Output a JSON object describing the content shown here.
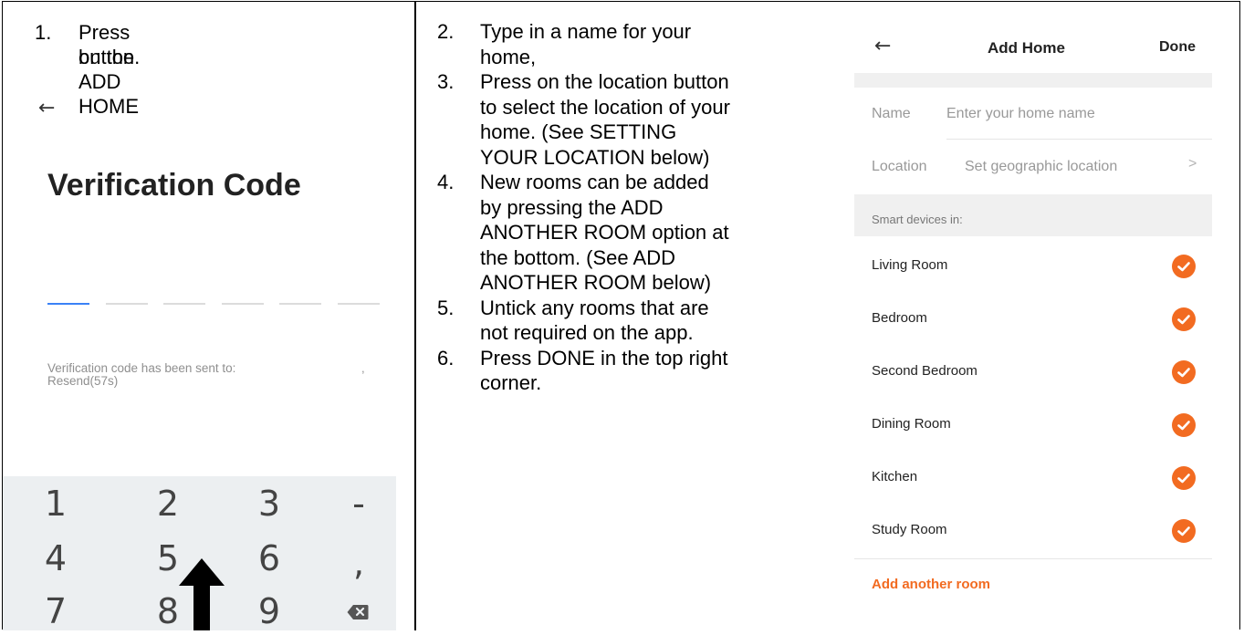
{
  "left": {
    "step": {
      "num": "1.",
      "line1": "Press on the ADD HOME",
      "line2": "button."
    },
    "screen": {
      "back_icon": "arrow-left-icon",
      "title": "Verification Code",
      "sent_text": "Verification code has been sent to:",
      "sent_suffix": ",",
      "resend_text": "Resend(57s)",
      "code_slots": 6,
      "active_slot": 0
    },
    "keypad": {
      "row1": [
        "1",
        "2",
        "3",
        "-"
      ],
      "row2": [
        "4",
        "5",
        "6",
        ","
      ],
      "row3": [
        "7",
        "8",
        "9"
      ],
      "backspace_icon": "backspace-icon"
    },
    "pointer_icon": "up-arrow-icon"
  },
  "middle": {
    "steps": [
      {
        "num": "2.",
        "lines": [
          "Type in a name for your",
          "home,"
        ]
      },
      {
        "num": "3.",
        "lines": [
          "Press on the location button",
          "to select the location of your",
          "home.  (See SETTING",
          "YOUR LOCATION below)"
        ]
      },
      {
        "num": "4.",
        "lines": [
          "New rooms can be added",
          "by pressing the ADD",
          "ANOTHER ROOM option at",
          "the bottom. (See ADD",
          "ANOTHER ROOM below)"
        ]
      },
      {
        "num": "5.",
        "lines": [
          "Untick any rooms that are",
          "not required on the app."
        ]
      },
      {
        "num": "6.",
        "lines": [
          "Press DONE in the top right",
          "corner."
        ]
      }
    ]
  },
  "right": {
    "header": {
      "back_icon": "arrow-left-icon",
      "title": "Add Home",
      "done_label": "Done"
    },
    "name_label": "Name",
    "name_placeholder": "Enter your home name",
    "location_label": "Location",
    "location_placeholder": "Set geographic location",
    "location_chevron": ">",
    "section_label": "Smart devices in:",
    "rooms": [
      "Living Room",
      "Bedroom",
      "Second Bedroom",
      "Dining Room",
      "Kitchen",
      "Study Room"
    ],
    "add_room_label": "Add another room",
    "accent_color": "#f26b21"
  }
}
